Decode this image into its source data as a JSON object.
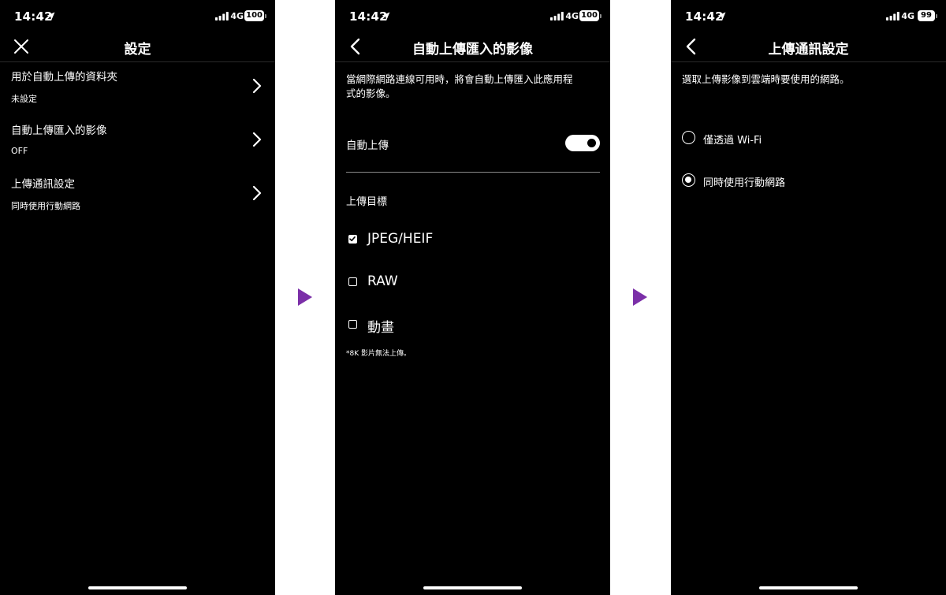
{
  "status_bar": {
    "time": "14:42",
    "network": "4G"
  },
  "screens": [
    {
      "battery": "100",
      "title": "設定",
      "items": [
        {
          "label": "用於自動上傳的資料夾",
          "value": "未設定"
        },
        {
          "label": "自動上傳匯入的影像",
          "value": "OFF"
        },
        {
          "label": "上傳通訊設定",
          "value": "同時使用行動網路"
        }
      ]
    },
    {
      "battery": "100",
      "title": "自動上傳匯入的影像",
      "description_line1": "當網際網路連線可用時，將會自動上傳匯入此應用程",
      "description_line2": "式的影像。",
      "toggle_label": "自動上傳",
      "toggle_on": true,
      "section_label": "上傳目標",
      "targets": [
        {
          "label": "JPEG/HEIF",
          "checked": true
        },
        {
          "label": "RAW",
          "checked": false
        },
        {
          "label": "動畫",
          "checked": false
        }
      ],
      "note": "*8K 影片無法上傳。"
    },
    {
      "battery": "99",
      "title": "上傳通訊設定",
      "description": "選取上傳影像到雲端時要使用的網路。",
      "options": [
        {
          "label": "僅透過 Wi-Fi",
          "selected": false
        },
        {
          "label": "同時使用行動網路",
          "selected": true
        }
      ]
    }
  ],
  "colors": {
    "accent_arrow": "#7b2fa8",
    "background": "#000000",
    "separator": "#ffffff"
  }
}
